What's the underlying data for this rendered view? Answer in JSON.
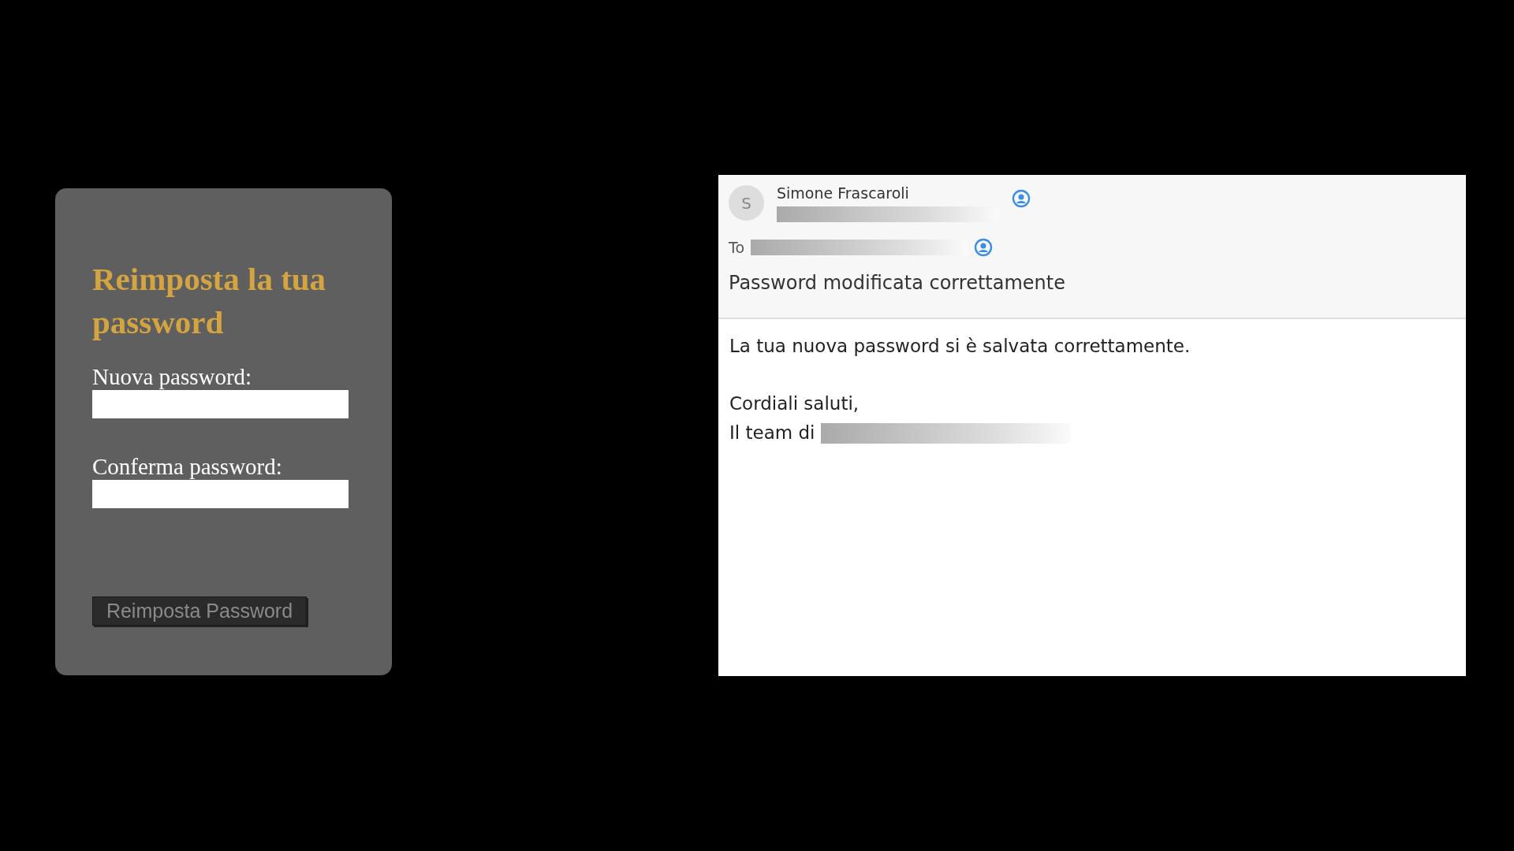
{
  "reset_form": {
    "title": "Reimposta la tua password",
    "fields": [
      {
        "label": "Nuova password:"
      },
      {
        "label": "Conferma password:"
      }
    ],
    "submit_button": {
      "label": "Reimposta Password",
      "disabled": true
    }
  },
  "email": {
    "sender": {
      "avatar_initial": "S",
      "name": "Simone Frascaroli"
    },
    "to_label": "To",
    "subject": "Password modificata correttamente",
    "paragraphs": [
      [
        "La tua nuova password si è salvata correttamente."
      ],
      [
        "Cordiali saluti,",
        "Il team di"
      ]
    ]
  }
}
